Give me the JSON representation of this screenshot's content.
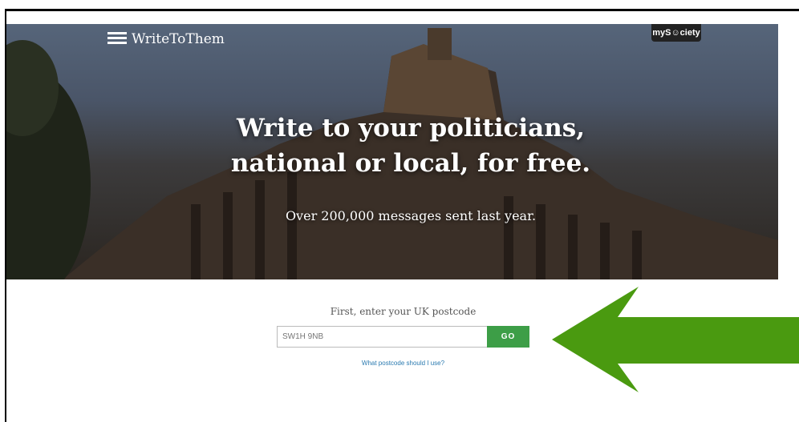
{
  "brand": {
    "name": "WriteToThem",
    "badge": "myS☺ciety"
  },
  "hero": {
    "headline_line1": "Write to your politicians,",
    "headline_line2": "national or local, for free.",
    "subheading": "Over 200,000 messages sent last year."
  },
  "form": {
    "prompt": "First, enter your UK postcode",
    "postcode_placeholder": "SW1H 9NB",
    "go_label": "GO",
    "help_link": "What postcode should I use?"
  },
  "colors": {
    "go_button": "#3d9e47",
    "link": "#2a7ab0",
    "arrow": "#4a9a10"
  },
  "icons": {
    "logo": "letter-stack-icon",
    "annotation": "arrow-left-icon"
  }
}
